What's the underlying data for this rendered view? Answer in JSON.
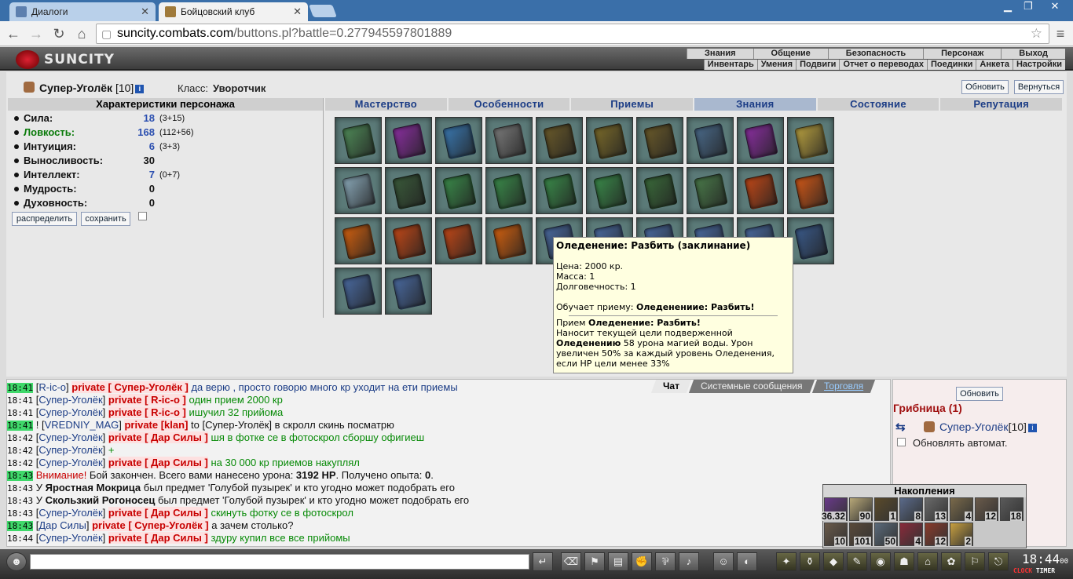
{
  "browser": {
    "tabs": [
      {
        "title": "Диалоги"
      },
      {
        "title": "Бойцовский клуб"
      }
    ],
    "url_host": "suncity.combats.com",
    "url_path": "/buttons.pl?battle=0.277945597801889"
  },
  "header": {
    "logo": "SUNCITY",
    "menu": [
      "Знания",
      "Общение",
      "Безопасность",
      "Персонаж",
      "Выход"
    ],
    "submenu": [
      "Инвентарь",
      "Умения",
      "Подвиги",
      "Отчет о переводах",
      "Поединки",
      "Анкета",
      "Настройки"
    ]
  },
  "character": {
    "name": "Супер-Уголёк",
    "level": "[10]",
    "info_icon": "i",
    "class_label": "Класс:",
    "class_value": "Уворотчик",
    "refresh_btn": "Обновить",
    "return_btn": "Вернуться"
  },
  "stats": {
    "header": "Характеристики персонажа",
    "items": [
      {
        "label": "Сила:",
        "value": "18",
        "bonus": "(3+15)",
        "color": "#111111"
      },
      {
        "label": "Ловкость:",
        "value": "168",
        "bonus": "(112+56)",
        "color": "#0a7a0a"
      },
      {
        "label": "Интуиция:",
        "value": "6",
        "bonus": "(3+3)",
        "color": "#111111"
      },
      {
        "label": "Выносливость:",
        "value": "30",
        "bonus": "",
        "color": "#111111"
      },
      {
        "label": "Интеллект:",
        "value": "7",
        "bonus": "(0+7)",
        "color": "#111111"
      },
      {
        "label": "Мудрость:",
        "value": "0",
        "bonus": "",
        "color": "#111111"
      },
      {
        "label": "Духовность:",
        "value": "0",
        "bonus": "",
        "color": "#111111"
      }
    ],
    "distribute_btn": "распределить",
    "save_btn": "сохранить"
  },
  "category_tabs": [
    "Мастерство",
    "Особенности",
    "Приемы",
    "Знания",
    "Состояние",
    "Репутация"
  ],
  "selected_tab": "Знания",
  "scroll_colors": [
    "#4f8a58",
    "#8a2fa0",
    "#3a78b0",
    "#7a7a7a",
    "#6a5a2a",
    "#7a6a2a",
    "#6a5a2a",
    "#4a6a8a",
    "#8a2fa0",
    "#b8a040",
    "#8aa8b8",
    "#3a5a3a",
    "#3a8a4a",
    "#3a8a4a",
    "#3a8a4a",
    "#3a8a4a",
    "#3a6a3a",
    "#4a7a4a",
    "#c04818",
    "#d05818",
    "#d06010",
    "#c04818",
    "#c04818",
    "#d06010",
    "#4a6aa0",
    "#4a6aa0",
    "#4a6aa0",
    "#4a6aa0",
    "#4a6aa0",
    "#3a5a8a",
    "#4a6aa0",
    "#4a6aa0"
  ],
  "tooltip": {
    "title": "Оледенение: Разбить (заклинание)",
    "price": "Цена: 2000 кр.",
    "mass": "Масса: 1",
    "durability": "Долговечность: 1",
    "teaches_prefix": "Обучает приему: ",
    "teaches_name": "Оледенениие: Разбить!",
    "skill_prefix": "Прием ",
    "skill_name": "Оледенение: Разбить!",
    "desc1": "Наносит текущей цели подверженной",
    "desc2_bold": "Оледенению",
    "desc2": " 58 урона магией воды. Урон",
    "desc3": "увеличен 50% за каждый уровень Оледенения,",
    "desc4": "если HP цели менее 33%"
  },
  "chat_tabs": [
    "Чат",
    "Системные сообщения",
    "Торговля"
  ],
  "chat": [
    {
      "time": "18:41",
      "hl": true,
      "nick": "R-ic-o",
      "priv": "private [ Супер-Уголёк ]",
      "text": "да верю , просто говорю много кр уходит на ети приемы",
      "tcolor": "#1c3d86"
    },
    {
      "time": "18:41",
      "hl": false,
      "nick": "Супер-Уголёк",
      "priv": "private [ R-ic-o ]",
      "text": "один прием 2000 кр",
      "tcolor": "#078a07"
    },
    {
      "time": "18:41",
      "hl": false,
      "nick": "Супер-Уголёк",
      "priv": "private [ R-ic-o ]",
      "text": "ишучил 32 прийома",
      "tcolor": "#078a07"
    },
    {
      "time": "18:41",
      "hl": true,
      "prefix": "! ",
      "nick": "VREDNIY_MAG",
      "priv": "private [klan]",
      "text": "to [Супер-Уголёк] в скролл скинь посматрю",
      "tcolor": "#111111"
    },
    {
      "time": "18:42",
      "hl": false,
      "nick": "Супер-Уголёк",
      "priv": "private [ Дар Силы ]",
      "text": "шя в фотке се в фотоскрол сборшу офигиеш",
      "tcolor": "#078a07"
    },
    {
      "time": "18:42",
      "hl": false,
      "nick": "Супер-Уголёк",
      "priv": "",
      "text": "+",
      "tcolor": "#078a07"
    },
    {
      "time": "18:42",
      "hl": false,
      "nick": "Супер-Уголёк",
      "priv": "private [ Дар Силы ]",
      "text": "на 30 000 кр приемов накуплял",
      "tcolor": "#078a07"
    },
    {
      "time": "18:43",
      "hl": true,
      "system": true,
      "sys_prefix": "Внимание!",
      "sys_text": " Бой закончен. Всего вами нанесено урона: ",
      "sys_b1": "3192 HP",
      "sys_mid": ". Получено опыта: ",
      "sys_b2": "0",
      "sys_end": "."
    },
    {
      "time": "18:43",
      "hl": false,
      "loot": true,
      "l_pre": "У ",
      "l_who": "Яростная Мокрица",
      "l_text": " был предмет 'Голубой пузырек' и кто угодно может подобрать его"
    },
    {
      "time": "18:43",
      "hl": false,
      "loot": true,
      "l_pre": "У ",
      "l_who": "Скользкий Рогоносец",
      "l_text": " был предмет 'Голубой пузырек' и кто угодно может подобрать его"
    },
    {
      "time": "18:43",
      "hl": false,
      "nick": "Супер-Уголёк",
      "priv": "private [ Дар Силы ]",
      "text": "скинуть фотку се в фотоскрол",
      "tcolor": "#078a07"
    },
    {
      "time": "18:43",
      "hl": true,
      "nick": "Дар Силы",
      "priv": "private [ Супер-Уголёк ]",
      "text": "а зачем столько?",
      "tcolor": "#111111"
    },
    {
      "time": "18:44",
      "hl": false,
      "nick": "Супер-Уголёк",
      "priv": "private [ Дар Силы ]",
      "text": "здуру купил все все прийомы",
      "tcolor": "#078a07"
    }
  ],
  "side": {
    "refresh": "Обновить",
    "location": "Грибница (1)",
    "user": "Супер-Уголёк",
    "user_level": "[10]",
    "auto": "Обновлять автомат."
  },
  "accum": {
    "title": "Накопления",
    "cells": [
      {
        "n": "36.32",
        "c": "#6a3a8a"
      },
      {
        "n": "90",
        "c": "#b8a878"
      },
      {
        "n": "1",
        "c": "#5a4a2a"
      },
      {
        "n": "8",
        "c": "#5a6a8a"
      },
      {
        "n": "13",
        "c": "#6a6a6a"
      },
      {
        "n": "4",
        "c": "#7a6a4a"
      },
      {
        "n": "12",
        "c": "#6a5a4a"
      },
      {
        "n": "18",
        "c": "#5a5a5a"
      },
      {
        "n": "10",
        "c": "#6a5a4a"
      },
      {
        "n": "101",
        "c": "#5a4a3a"
      },
      {
        "n": "50",
        "c": "#5a6a7a"
      },
      {
        "n": "4",
        "c": "#8a2a3a"
      },
      {
        "n": "12",
        "c": "#8a3a2a"
      },
      {
        "n": "2",
        "c": "#c8a040"
      }
    ]
  },
  "clock": {
    "time": "18:44",
    "sec": "00",
    "clock_lbl": "CLOCK",
    "timer_lbl": "TIMER"
  }
}
